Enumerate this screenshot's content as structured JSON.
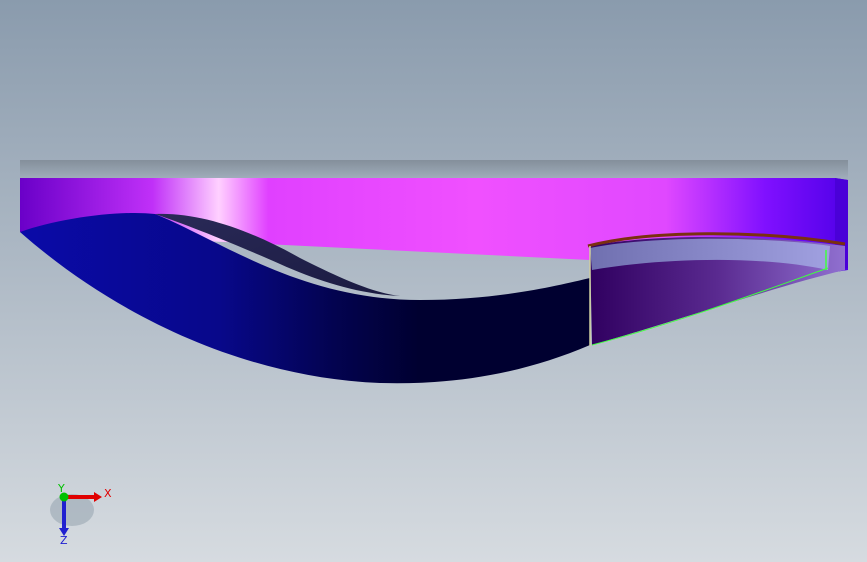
{
  "viewport": {
    "background_top": "#8a9bad",
    "background_bottom": "#d6dbe0"
  },
  "model": {
    "top_face_colors": [
      "#6a00c8",
      "#d040ff",
      "#ffd0ff",
      "#e040ff",
      "#f050ff",
      "#c030ff",
      "#6000f0"
    ],
    "front_face_colors": [
      "#0a0aa0",
      "#000030"
    ],
    "cavity_colors": [
      "#303060",
      "#101030"
    ],
    "cutaway_colors": [
      "#6040a0",
      "#200040"
    ],
    "edge_highlight": "#40ff40"
  },
  "triad": {
    "x_label": "X",
    "y_label": "Y",
    "z_label": "Z",
    "x_color": "#e00000",
    "y_color": "#00c000",
    "z_color": "#2020d0"
  }
}
